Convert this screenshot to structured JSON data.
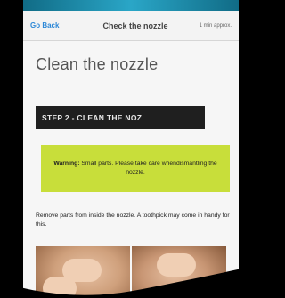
{
  "header": {
    "back_label": "Go Back",
    "title": "Check the nozzle",
    "duration": "1 min approx."
  },
  "page": {
    "title": "Clean the nozzle"
  },
  "step_banner": {
    "label": "STEP 2 - CLEAN THE NOZ"
  },
  "warning": {
    "bold": "Warning:",
    "text": " Small parts. Please take care whendismantling the nozzle."
  },
  "instructions": {
    "text": "Remove parts from inside the nozzle. A toothpick may come in handy for this."
  },
  "colors": {
    "link": "#2c87d6",
    "warning_bg": "#c8de3a",
    "step_bg": "#1f1f1f"
  }
}
